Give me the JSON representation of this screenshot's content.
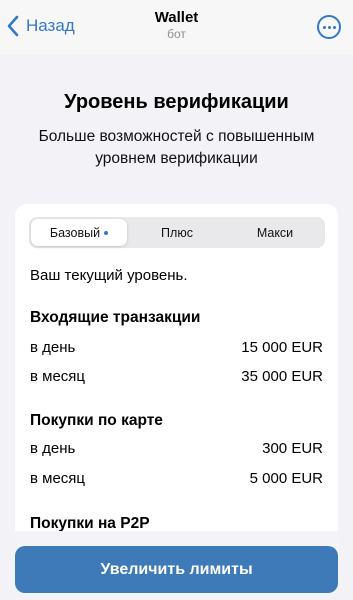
{
  "header": {
    "back_label": "Назад",
    "title": "Wallet",
    "subtitle": "бот"
  },
  "intro": {
    "heading": "Уровень верификации",
    "description": "Больше возможностей с повышенным уровнем верификации"
  },
  "tabs": [
    {
      "label": "Базовый",
      "active": true
    },
    {
      "label": "Плюс",
      "active": false
    },
    {
      "label": "Макси",
      "active": false
    }
  ],
  "current_level_text": "Ваш текущий уровень.",
  "sections": [
    {
      "title": "Входящие транзакции",
      "rows": [
        {
          "label": "в день",
          "value": "15 000 EUR"
        },
        {
          "label": "в месяц",
          "value": "35 000 EUR"
        }
      ]
    },
    {
      "title": "Покупки по карте",
      "rows": [
        {
          "label": "в день",
          "value": "300 EUR"
        },
        {
          "label": "в месяц",
          "value": "5 000 EUR"
        }
      ]
    },
    {
      "title": "Покупки на P2P",
      "rows": []
    }
  ],
  "cta_label": "Увеличить лимиты",
  "colors": {
    "accent": "#3478c9",
    "cta_bg": "#3e7ab8",
    "page_bg": "#f2f2f7"
  }
}
